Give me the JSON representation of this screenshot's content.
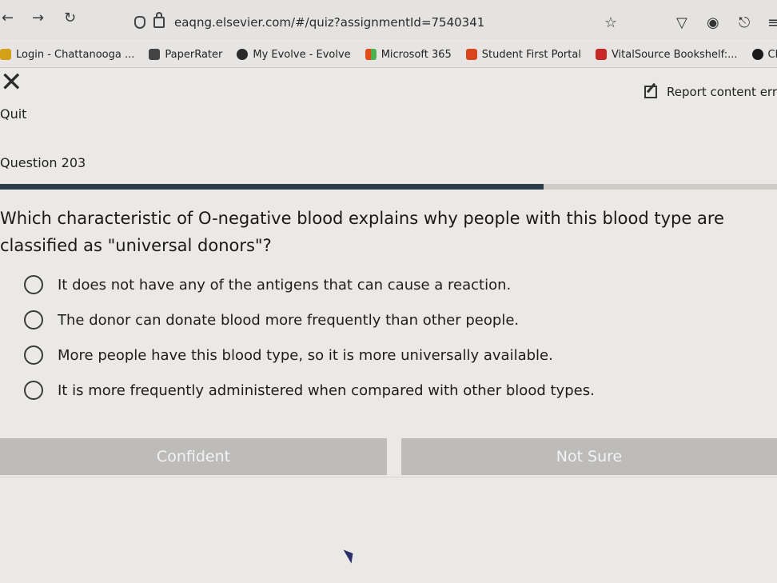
{
  "browser": {
    "url": "eaqng.elsevier.com/#/quiz?assignmentId=7540341",
    "bookmarks": [
      {
        "label": "Login - Chattanooga ...",
        "icon": "chattanooga-logo-icon",
        "color": "#d4a017"
      },
      {
        "label": "PaperRater",
        "icon": "pen-logo-icon",
        "color": "#444444"
      },
      {
        "label": "My Evolve - Evolve",
        "icon": "evolve-logo-icon",
        "color": "#2a2a2a"
      },
      {
        "label": "Microsoft 365",
        "icon": "microsoft-logo-icon",
        "color": "#e64a19"
      },
      {
        "label": "Student First Portal",
        "icon": "portal-logo-icon",
        "color": "#d9441c"
      },
      {
        "label": "VitalSource Bookshelf:...",
        "icon": "vitalsource-logo-icon",
        "color": "#c62828"
      },
      {
        "label": "ChatGPT",
        "icon": "chatgpt-logo-icon",
        "color": "#1a1a1a"
      }
    ]
  },
  "quiz": {
    "quit_label": "Quit",
    "report_label": "Report content erro",
    "question_number": "Question 203",
    "progress_fraction": 0.7,
    "question_text": "Which characteristic of O-negative blood explains why people with this blood type are classified as \"universal donors\"?",
    "options": [
      "It does not have any of the antigens that can cause a reaction.",
      "The donor can donate blood more frequently than other people.",
      "More people have this blood type, so it is more universally available.",
      "It is more frequently administered when compared with other blood types."
    ],
    "confident_label": "Confident",
    "not_sure_label": "Not Sure"
  },
  "colors": {
    "progress": "#2f3d4a",
    "button": "#bdbcba"
  }
}
